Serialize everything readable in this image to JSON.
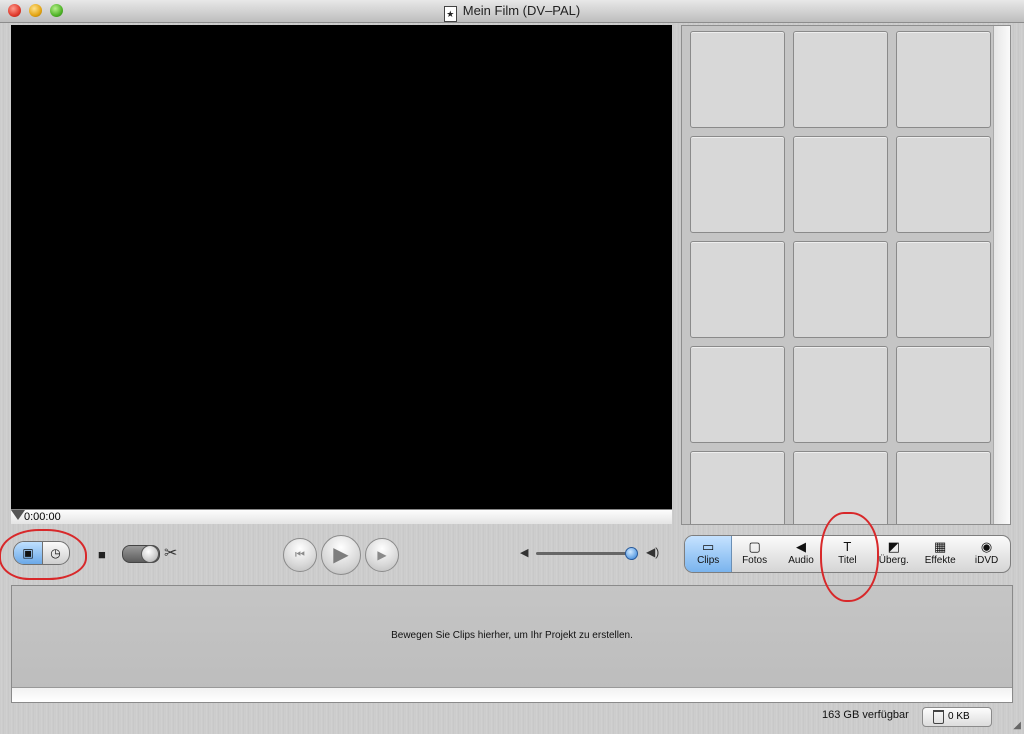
{
  "window": {
    "title": "Mein Film (DV–PAL)"
  },
  "viewer": {
    "timecode": "0:00:00"
  },
  "shelf": {
    "rows": 5,
    "cols": 3
  },
  "transport": {
    "rewind_icon": "⏮",
    "play_icon": "▶",
    "fullscreen_icon": "▶"
  },
  "icons": {
    "camera": "camera-icon",
    "scissors": "scissors-icon",
    "clip_view": "film-icon",
    "time_view": "clock-icon",
    "volume_low": "volume-low-icon",
    "volume_high": "volume-high-icon"
  },
  "volume": {
    "level": 0.95
  },
  "panes": [
    {
      "id": "clips",
      "label": "Clips",
      "icon": "▭",
      "selected": true
    },
    {
      "id": "fotos",
      "label": "Fotos",
      "icon": "▢",
      "selected": false
    },
    {
      "id": "audio",
      "label": "Audio",
      "icon": "◀",
      "selected": false
    },
    {
      "id": "titel",
      "label": "Titel",
      "icon": "T",
      "selected": false
    },
    {
      "id": "uberg",
      "label": "Überg.",
      "icon": "◩",
      "selected": false
    },
    {
      "id": "effekte",
      "label": "Effekte",
      "icon": "▦",
      "selected": false
    },
    {
      "id": "idvd",
      "label": "iDVD",
      "icon": "◉",
      "selected": false
    }
  ],
  "timeline": {
    "message": "Bewegen Sie Clips hierher, um Ihr Projekt zu erstellen."
  },
  "status": {
    "free_space": "163 GB verfügbar",
    "trash": "0 KB"
  },
  "colors": {
    "annotation": "#d8282a",
    "selected": "#7ab4ee"
  }
}
